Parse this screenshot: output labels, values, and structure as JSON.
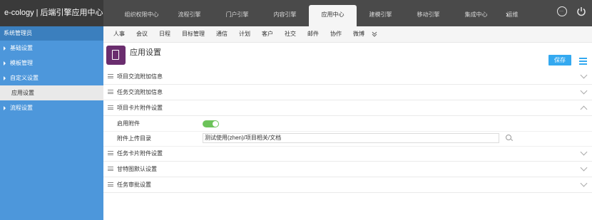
{
  "app": {
    "title": "e-cology | 后端引擎应用中心"
  },
  "top_tabs": [
    {
      "label": "组织权限中心"
    },
    {
      "label": "流程引擎"
    },
    {
      "label": "门户引擎"
    },
    {
      "label": "内容引擎"
    },
    {
      "label": "应用中心",
      "active": true
    },
    {
      "label": "建模引擎"
    },
    {
      "label": "移动引擎"
    },
    {
      "label": "集成中心"
    },
    {
      "label": "运维"
    }
  ],
  "top_icons": [
    "chat-icon",
    "power-icon"
  ],
  "sidebar": {
    "header": "系统管理员",
    "items": [
      {
        "label": "基础设置"
      },
      {
        "label": "模板管理"
      },
      {
        "label": "自定义设置"
      },
      {
        "label": "应用设置",
        "selected": true
      },
      {
        "label": "流程设置"
      }
    ]
  },
  "subnav": [
    "人事",
    "会议",
    "日程",
    "目标管理",
    "通信",
    "计划",
    "客户",
    "社交",
    "邮件",
    "协作",
    "微博"
  ],
  "page": {
    "title": "应用设置",
    "save_label": "保存"
  },
  "sections": [
    {
      "label": "项目交流附加信息"
    },
    {
      "label": "任务交流附加信息"
    },
    {
      "label": "项目卡片附件设置",
      "expanded": true
    },
    {
      "label": "任务卡片附件设置"
    },
    {
      "label": "甘特图默认设置"
    },
    {
      "label": "任务审批设置"
    }
  ],
  "settings": {
    "enable_attachment": {
      "label": "启用附件",
      "value": true
    },
    "upload_dir": {
      "label": "附件上传目录",
      "value": "测试使用(zhen)/项目相关/文档"
    }
  },
  "colors": {
    "accent": "#34a9f0",
    "sidebar": "#4d97db",
    "toggle_on": "#6cc35a",
    "topbar": "#4a4a4a"
  }
}
